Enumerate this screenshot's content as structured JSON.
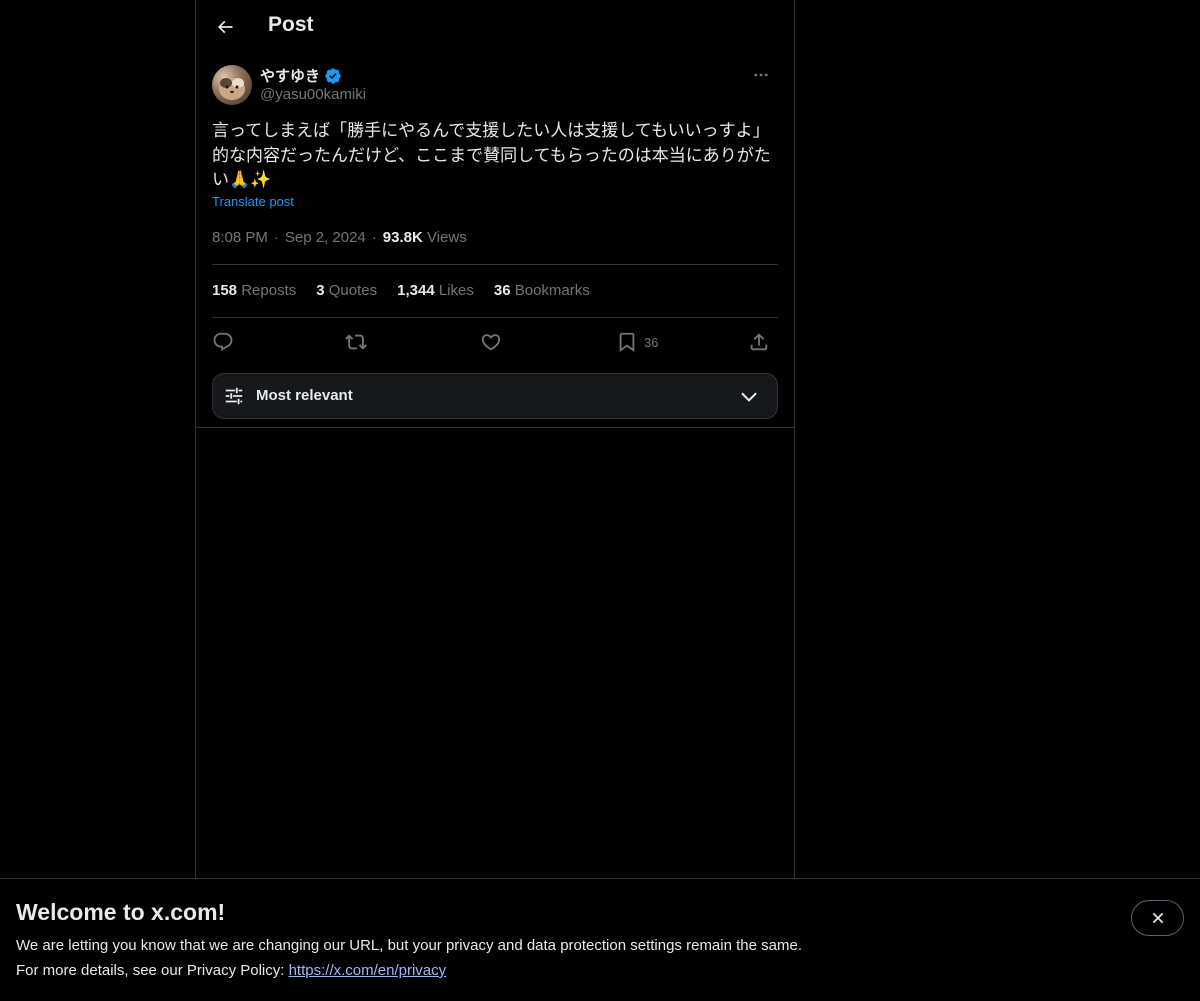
{
  "header": {
    "title": "Post"
  },
  "post": {
    "author": {
      "name": "やすゆき",
      "handle": "@yasu00kamiki",
      "verified": true
    },
    "text": "言ってしまえば「勝手にやるんで支援したい人は支援してもいいっすよ」\n的な内容だったんだけど、ここまで賛同してもらったのは本当にありがた\nい🙏✨",
    "translate_label": "Translate post",
    "time": "8:08 PM",
    "date": "Sep 2, 2024",
    "views_count": "93.8K",
    "views_label": "Views",
    "stats": {
      "reposts_count": "158",
      "reposts_label": "Reposts",
      "quotes_count": "3",
      "quotes_label": "Quotes",
      "likes_count": "1,344",
      "likes_label": "Likes",
      "bookmarks_count": "36",
      "bookmarks_label": "Bookmarks"
    },
    "actions": {
      "bookmark_count": "36"
    }
  },
  "sort": {
    "label": "Most relevant"
  },
  "banner": {
    "title": "Welcome to x.com!",
    "line1": "We are letting you know that we are changing our URL, but your privacy and data protection settings remain the same.",
    "line2_prefix": "For more details, see our Privacy Policy: ",
    "link": "https://x.com/en/privacy"
  },
  "colors": {
    "background": "#000000",
    "text_primary": "#e7e9ea",
    "text_secondary": "#71767b",
    "accent": "#1d9bf0",
    "border": "#2f3336",
    "link": "#a5b4fc"
  },
  "icons": {
    "back": "arrow-left-icon",
    "verified": "verified-badge-icon",
    "more": "more-horizontal-icon",
    "reply": "reply-icon",
    "repost": "repost-icon",
    "like": "heart-icon",
    "bookmark": "bookmark-icon",
    "share": "share-icon",
    "sort": "sliders-icon",
    "chevron": "chevron-down-icon",
    "close": "close-icon"
  }
}
